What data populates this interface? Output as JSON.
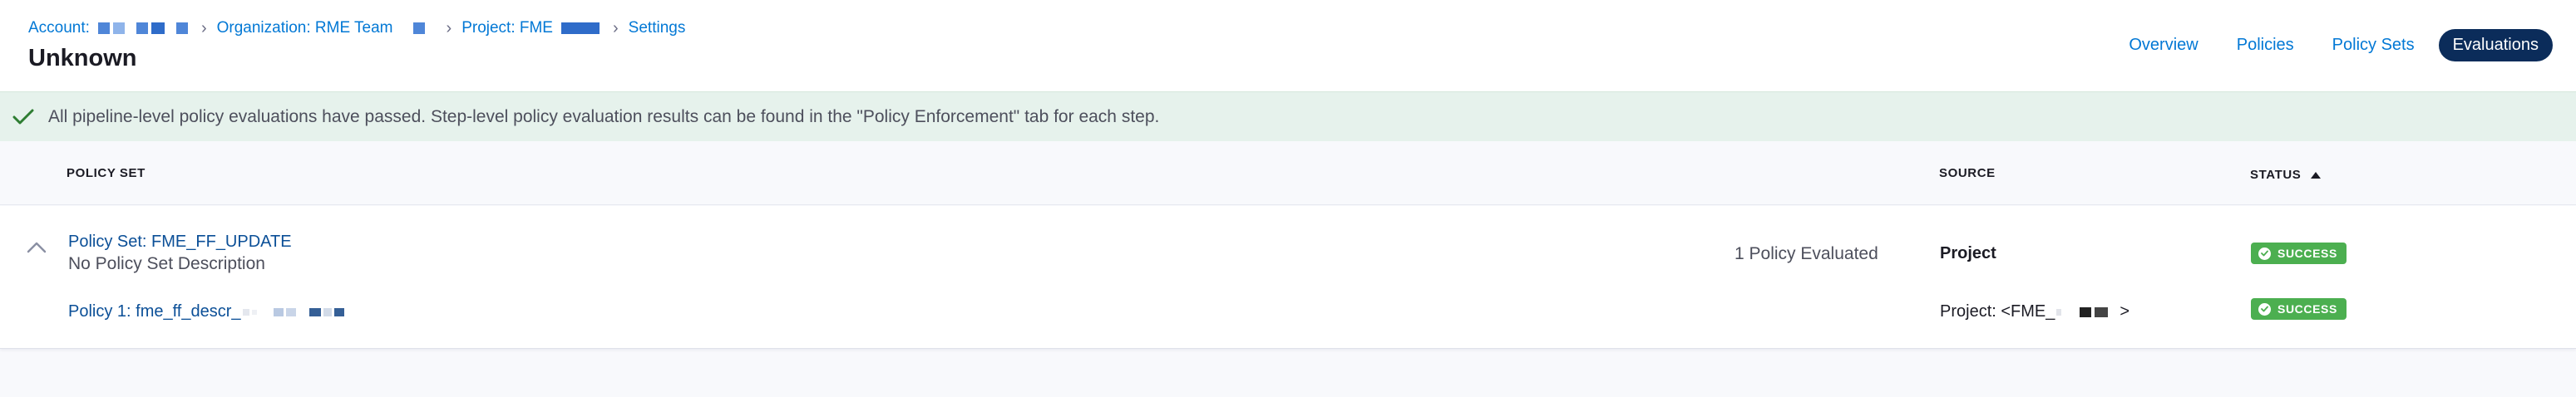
{
  "breadcrumb": {
    "account_label": "Account:",
    "organization_label": "Organization: RME Team",
    "project_label": "Project: FME",
    "settings_label": "Settings"
  },
  "page": {
    "title": "Unknown"
  },
  "tabs": [
    {
      "label": "Overview",
      "active": false
    },
    {
      "label": "Policies",
      "active": false
    },
    {
      "label": "Policy Sets",
      "active": false
    },
    {
      "label": "Evaluations",
      "active": true
    }
  ],
  "banner": {
    "text": "All pipeline-level policy evaluations have passed. Step-level policy evaluation results can be found in the \"Policy Enforcement\" tab for each step.",
    "icon": "checkmark-icon"
  },
  "table": {
    "headers": {
      "policy_set": "POLICY SET",
      "source": "SOURCE",
      "status": "STATUS"
    },
    "sort": {
      "column": "status",
      "direction": "ascending"
    },
    "rows": [
      {
        "name": "Policy Set: FME_FF_UPDATE",
        "description": "No Policy Set Description",
        "evaluated": "1 Policy Evaluated",
        "source": "Project",
        "status": "SUCCESS",
        "policies": [
          {
            "name": "Policy 1: fme_ff_descr_",
            "source_prefix": "Project: <FME_",
            "source_suffix": ">",
            "status": "SUCCESS"
          }
        ]
      }
    ]
  },
  "colors": {
    "link": "#0278d5",
    "active_tab_bg": "#0b2c5a",
    "banner_bg": "#e6f2ec",
    "success_green": "#4caf50",
    "check_green": "#2e7d32"
  }
}
